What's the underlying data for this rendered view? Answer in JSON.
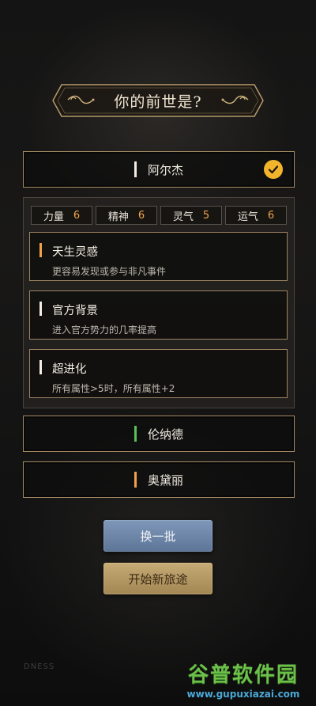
{
  "header": {
    "title": "你的前世是?"
  },
  "lives": [
    {
      "name": "阿尔杰",
      "bar_color": "#f2ede3",
      "selected": true
    },
    {
      "name": "伦纳德",
      "bar_color": "#5bbf5a",
      "selected": false
    },
    {
      "name": "奥黛丽",
      "bar_color": "#f0a24a",
      "selected": false
    }
  ],
  "stats": [
    {
      "label": "力量",
      "value": "6"
    },
    {
      "label": "精神",
      "value": "6"
    },
    {
      "label": "灵气",
      "value": "5"
    },
    {
      "label": "运气",
      "value": "6"
    }
  ],
  "talents": [
    {
      "name": "天生灵感",
      "desc": "更容易发现或参与非凡事件",
      "bar_color": "#f0a24a"
    },
    {
      "name": "官方背景",
      "desc": "进入官方势力的几率提高",
      "bar_color": "#f2ede3"
    },
    {
      "name": "超进化",
      "desc": "所有属性>5时，所有属性+2",
      "bar_color": "#f2ede3"
    }
  ],
  "buttons": {
    "reroll": "换一批",
    "start": "开始新旅途"
  },
  "background_text": "DNESS",
  "watermark": {
    "title": "谷普软件园",
    "url": "www.gupuxiazai.com"
  },
  "colors": {
    "frame": "#a58a63",
    "accent_orange": "#f0a24a",
    "check_yellow": "#f2b42c"
  }
}
